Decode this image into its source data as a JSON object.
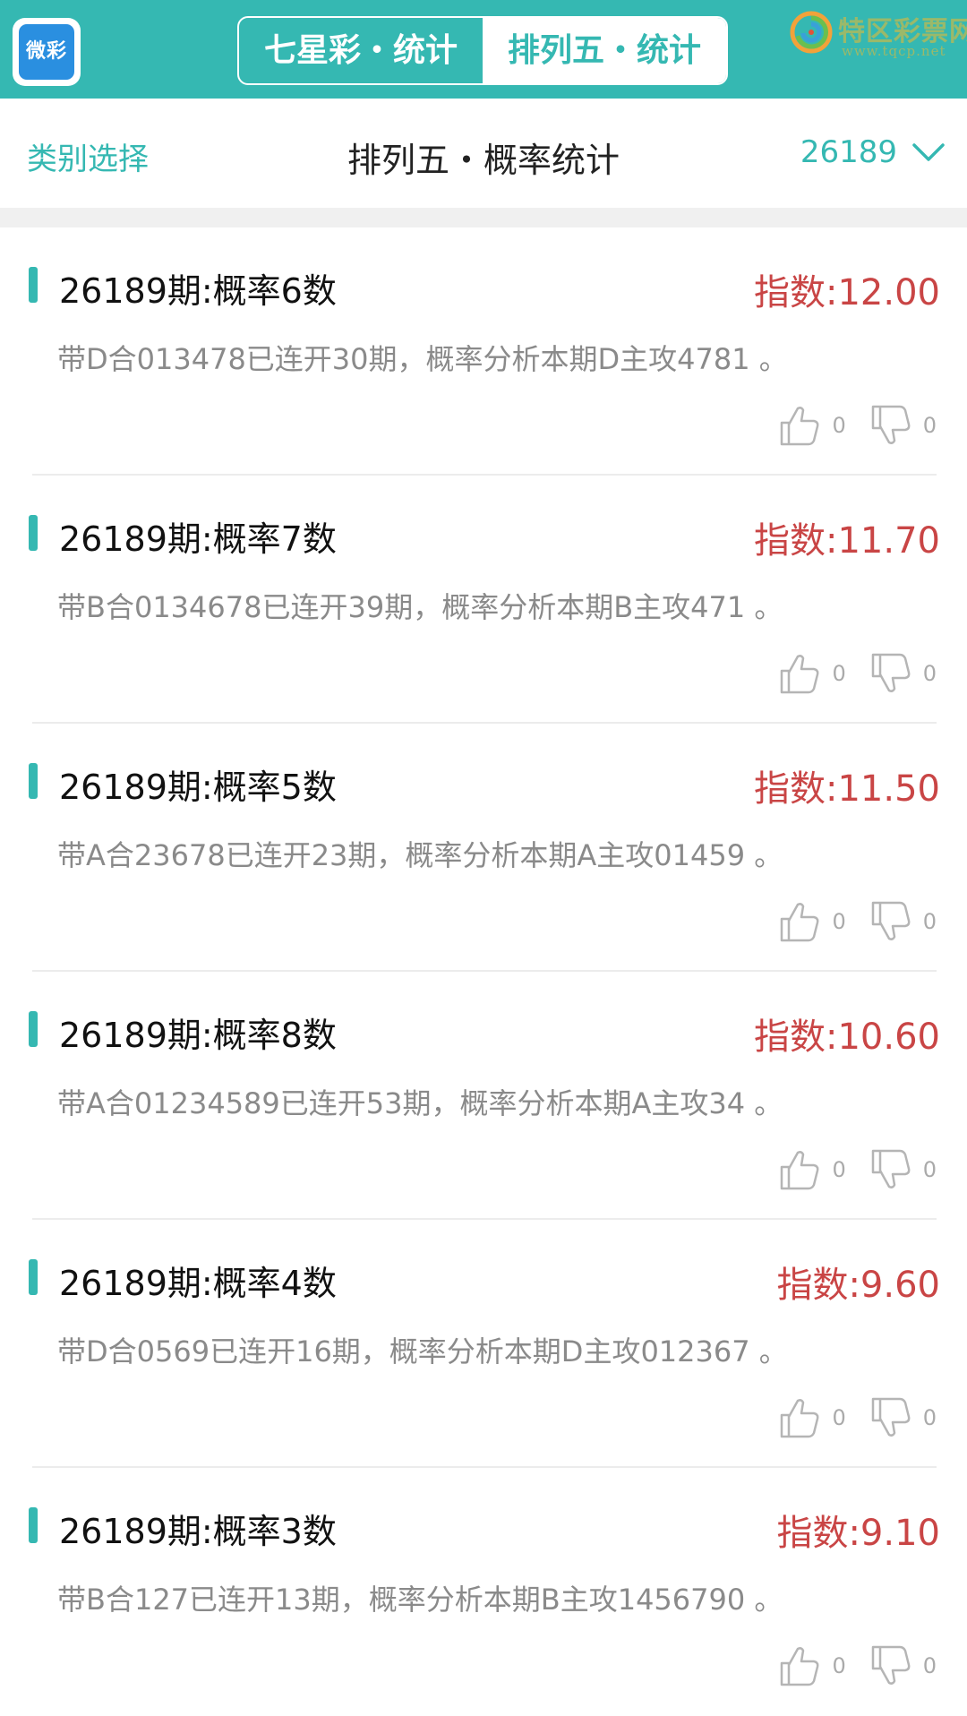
{
  "header": {
    "logo_text": "微彩",
    "tabs": [
      {
        "label": "七星彩・统计",
        "active": false
      },
      {
        "label": "排列五・统计",
        "active": true
      }
    ],
    "site_name": "特区彩票网",
    "site_url": "www.tqcp.net"
  },
  "subheader": {
    "category_label": "类别选择",
    "title": "排列五・概率统计",
    "period": "26189"
  },
  "colors": {
    "accent": "#35b8b2",
    "index_red": "#c94545",
    "desc_gray": "#8a8a8a"
  },
  "items": [
    {
      "title": "26189期:概率6数",
      "index": "指数:12.00",
      "desc": "带D合013478已连开30期，概率分析本期D主攻4781 。",
      "likes": "0",
      "dislikes": "0"
    },
    {
      "title": "26189期:概率7数",
      "index": "指数:11.70",
      "desc": "带B合0134678已连开39期，概率分析本期B主攻471 。",
      "likes": "0",
      "dislikes": "0"
    },
    {
      "title": "26189期:概率5数",
      "index": "指数:11.50",
      "desc": "带A合23678已连开23期，概率分析本期A主攻01459 。",
      "likes": "0",
      "dislikes": "0"
    },
    {
      "title": "26189期:概率8数",
      "index": "指数:10.60",
      "desc": "带A合01234589已连开53期，概率分析本期A主攻34 。",
      "likes": "0",
      "dislikes": "0"
    },
    {
      "title": "26189期:概率4数",
      "index": "指数:9.60",
      "desc": "带D合0569已连开16期，概率分析本期D主攻012367 。",
      "likes": "0",
      "dislikes": "0"
    },
    {
      "title": "26189期:概率3数",
      "index": "指数:9.10",
      "desc": "带B合127已连开13期，概率分析本期B主攻1456790 。",
      "likes": "0",
      "dislikes": "0"
    }
  ]
}
